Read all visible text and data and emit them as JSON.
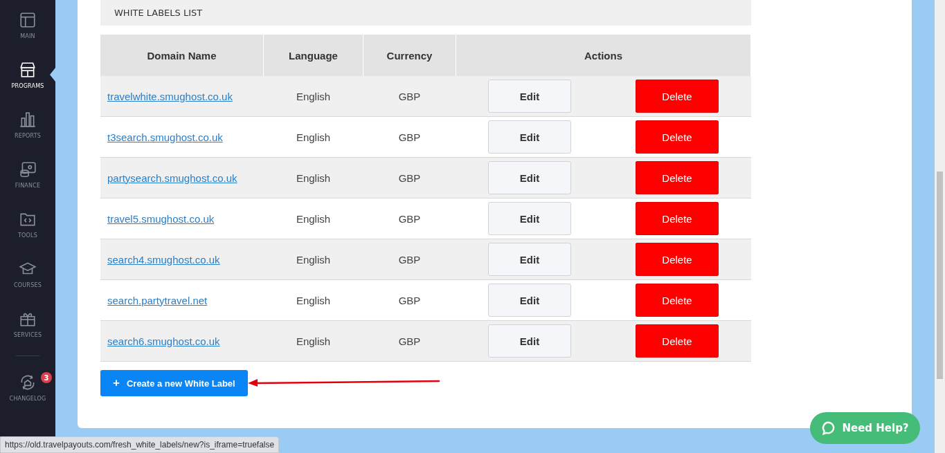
{
  "sidebar": {
    "items": [
      {
        "label": "MAIN",
        "selected": false
      },
      {
        "label": "PROGRAMS",
        "selected": true
      },
      {
        "label": "REPORTS",
        "selected": false
      },
      {
        "label": "FINANCE",
        "selected": false
      },
      {
        "label": "TOOLS",
        "selected": false
      },
      {
        "label": "COURSES",
        "selected": false
      },
      {
        "label": "SERVICES",
        "selected": false
      }
    ],
    "footer_item": {
      "label": "CHANGELOG",
      "badge": "3"
    }
  },
  "section": {
    "title": "WHITE LABELS LIST"
  },
  "table": {
    "columns": [
      "Domain Name",
      "Language",
      "Currency",
      "Actions"
    ],
    "rows": [
      {
        "domain": "travelwhite.smughost.co.uk",
        "language": "English",
        "currency": "GBP",
        "edit": "Edit",
        "delete": "Delete"
      },
      {
        "domain": "t3search.smughost.co.uk",
        "language": "English",
        "currency": "GBP",
        "edit": "Edit",
        "delete": "Delete"
      },
      {
        "domain": "partysearch.smughost.co.uk",
        "language": "English",
        "currency": "GBP",
        "edit": "Edit",
        "delete": "Delete"
      },
      {
        "domain": "travel5.smughost.co.uk",
        "language": "English",
        "currency": "GBP",
        "edit": "Edit",
        "delete": "Delete"
      },
      {
        "domain": "search4.smughost.co.uk",
        "language": "English",
        "currency": "GBP",
        "edit": "Edit",
        "delete": "Delete"
      },
      {
        "domain": "search.partytravel.net",
        "language": "English",
        "currency": "GBP",
        "edit": "Edit",
        "delete": "Delete"
      },
      {
        "domain": "search6.smughost.co.uk",
        "language": "English",
        "currency": "GBP",
        "edit": "Edit",
        "delete": "Delete"
      }
    ]
  },
  "create_button": {
    "icon": "+",
    "label": "Create a new White Label"
  },
  "help_button": {
    "label": "Need Help?"
  },
  "status_bar": {
    "url": "https://old.travelpayouts.com/fresh_white_labels/new?is_iframe=truefalse"
  }
}
